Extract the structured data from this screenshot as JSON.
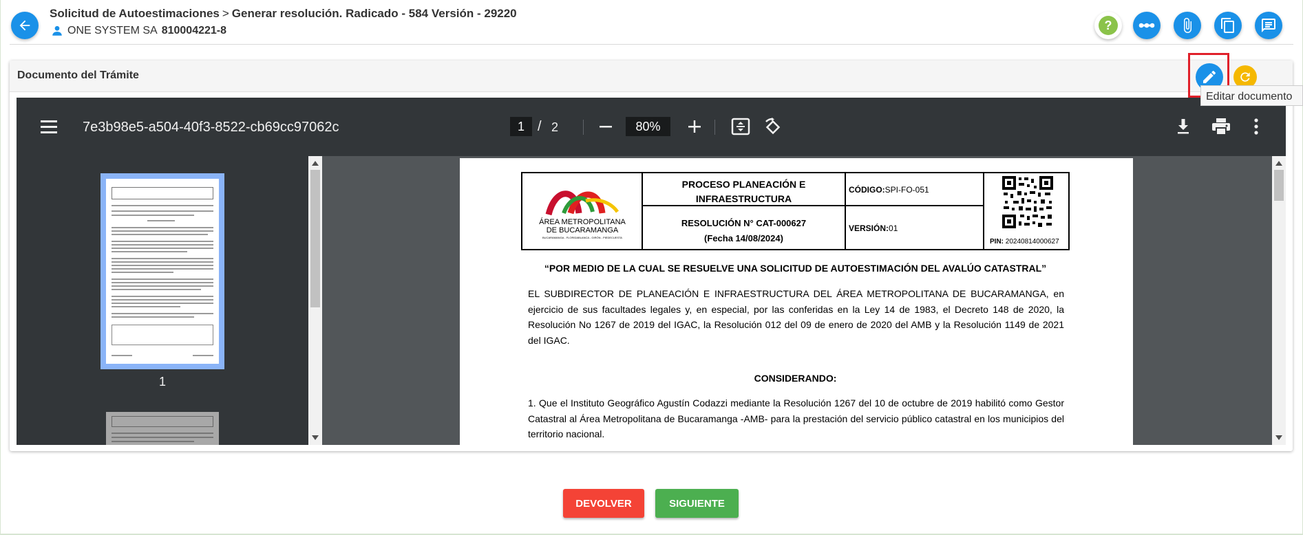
{
  "header": {
    "breadcrumb_parent": "Solicitud de Autoestimaciones",
    "breadcrumb_separator": ">",
    "breadcrumb_current": "Generar resolución. Radicado - 584 Versión - 29220",
    "owner_name": "ONE SYSTEM SA",
    "owner_nit": "810004221-8",
    "toolbar_icons": [
      "help-icon",
      "more-horizontal-icon",
      "attachment-icon",
      "documents-icon",
      "notes-icon"
    ],
    "accent_color": "#1a91e8",
    "help_color": "#8bc34a"
  },
  "card": {
    "title": "Documento del Trámite",
    "tooltip": "Editar documento",
    "edit_icon": "pencil-icon",
    "refresh_icon": "refresh-icon",
    "refresh_color": "#f5b800",
    "highlight_color": "#e0202a"
  },
  "viewer": {
    "file_name": "7e3b98e5-a504-40f3-8522-cb69cc97062c",
    "current_page": "1",
    "page_separator": "/",
    "total_pages": "2",
    "zoom": "80%",
    "thumbnail_label": "1"
  },
  "document": {
    "logo_name": "ÁREA METROPOLITANA",
    "logo_city": "DE BUCARAMANGA",
    "logo_tagline": "BUCARAMANGA - FLORIDABLANCA - GIRÓN - PIEDECUESTA",
    "process_line1": "PROCESO PLANEACIÓN E",
    "process_line2": "INFRAESTRUCTURA",
    "resolution_line1": "RESOLUCIÓN N° CAT-000627",
    "resolution_line2": "(Fecha 14/08/2024)",
    "code_label": "CÓDIGO:",
    "code_value": "SPI-FO-051",
    "version_label": "VERSIÓN:",
    "version_value": "01",
    "pin_label": "PIN:",
    "pin_value": "20240814000627",
    "heading": "“POR MEDIO DE LA CUAL SE RESUELVE UNA SOLICITUD DE AUTOESTIMACIÓN DEL AVALÚO CATASTRAL”",
    "paragraph1": "EL SUBDIRECTOR DE PLANEACIÓN E INFRAESTRUCTURA DEL ÁREA METROPOLITANA DE BUCARAMANGA, en ejercicio de sus facultades legales y, en especial, por las conferidas en la Ley 14 de 1983, el Decreto 148 de 2020, la Resolución No 1267 de 2019 del IGAC, la Resolución 012 del 09 de enero de 2020 del AMB y la Resolución 1149 de 2021 del IGAC.",
    "considerando": "CONSIDERANDO:",
    "paragraph2": "1. Que el Instituto Geográfico Agustín Codazzi mediante la Resolución 1267 del 10 de octubre de 2019 habilitó como Gestor Catastral al Área Metropolitana de Bucaramanga -AMB- para la prestación del servicio público catastral en los municipios del territorio nacional."
  },
  "actions": {
    "return_label": "DEVOLVER",
    "next_label": "SIGUIENTE",
    "return_color": "#f44336",
    "next_color": "#4caf50"
  }
}
